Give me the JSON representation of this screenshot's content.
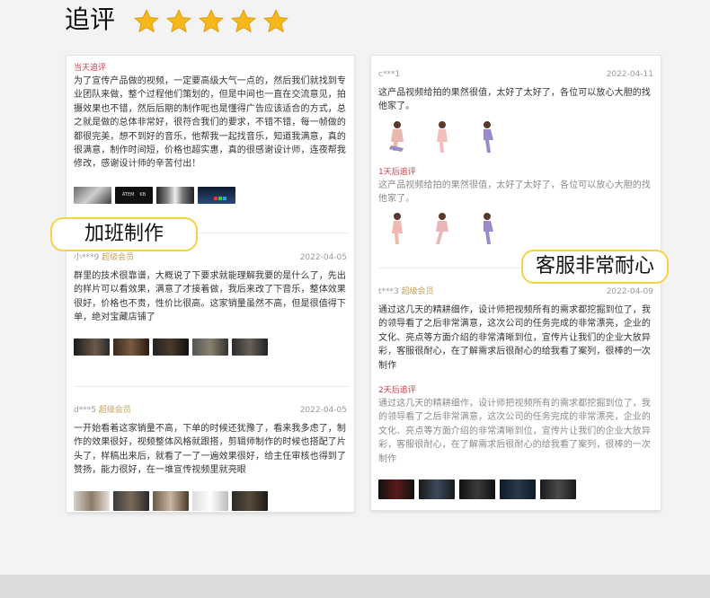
{
  "title": "追评",
  "stars_count": 5,
  "star_color": "#f6b81a",
  "accent_yellow": "#f4d346",
  "left_card": {
    "review1": {
      "tag": "当天追评",
      "text": "为了宣传产品做的视频，一定要高级大气一点的，然后我们就找到专业团队来做，整个过程他们策划的，但是中间也一直在交流意见，拍摄效果也不错，然后后期的制作呢也是懂得广告应该适合的方式，总之就是做的总体非常好，很符合我们的要求，不错不错，每一帧做的都很完美，想不到好的音乐，他帮我一起找音乐，知道我满意，真的很满意，制作时间短，价格也超实惠，真的很感谢设计师，连夜帮我修改，感谢设计师的辛苦付出！",
      "thumb_labels": [
        "",
        "ATEM",
        "KB",
        "",
        ""
      ]
    },
    "bubble1": "加班制作",
    "review2": {
      "user": "小***9",
      "level": "超级会员",
      "date": "2022-04-05",
      "text": "群里的技术很靠谱，大概说了下要求就能理解我要的是什么了，先出的样片可以看效果，满意了才接着做，我后来改了下音乐，整体效果很好，价格也不贵，性价比很高。这家销量虽然不高，但是很值得下单，绝对宝藏店铺了"
    },
    "review3": {
      "user": "d***5",
      "level": "超级会员",
      "date": "2022-04-05",
      "text": "一开始看着这家销量不高，下单的时候还犹豫了，看来我多虑了，制作的效果很好，视频整体风格就跟搭，剪辑师制作的时候也搭配了片头了，样稿出来后，就看了一了一遍效果很好，给主任审核也得到了赞扬，能力很好，在一堆宣传视频里就亮眼"
    }
  },
  "right_card": {
    "review1": {
      "user": "c***1",
      "date": "2022-04-11",
      "text": "这产品视频给拍的果然很值，太好了太好了，各位可以放心大胆的找他家了。",
      "followup_tag": "1天后追评",
      "followup_text": "这产品视频给拍的果然很值，太好了太好了，各位可以放心大胆的找他家了。"
    },
    "bubble2": "客服非常耐心",
    "review2": {
      "user": "t***3",
      "level": "超级会员",
      "date": "2022-04-09",
      "text": "通过这几天的精耕细作，设计师把视频所有的需求都挖掘到位了，我的领导看了之后非常满意，这次公司的任务完成的非常漂亮，企业的文化、亮点等方面介绍的非常清晰到位，宣传片让我们的企业大放异彩，客服很耐心，在了解需求后很耐心的给我看了案列，很棒的一次制作",
      "followup_tag": "2天后追评",
      "followup_text": "通过这几天的精耕细作，设计师把视频所有的需求都挖掘到位了，我的领导看了之后非常满意，这次公司的任务完成的非常漂亮，企业的文化、亮点等方面介绍的非常清晰到位，宣传片让我们的企业大放异彩，客服很耐心，在了解需求后很耐心的给我看了案列，很棒的一次制作"
    }
  }
}
